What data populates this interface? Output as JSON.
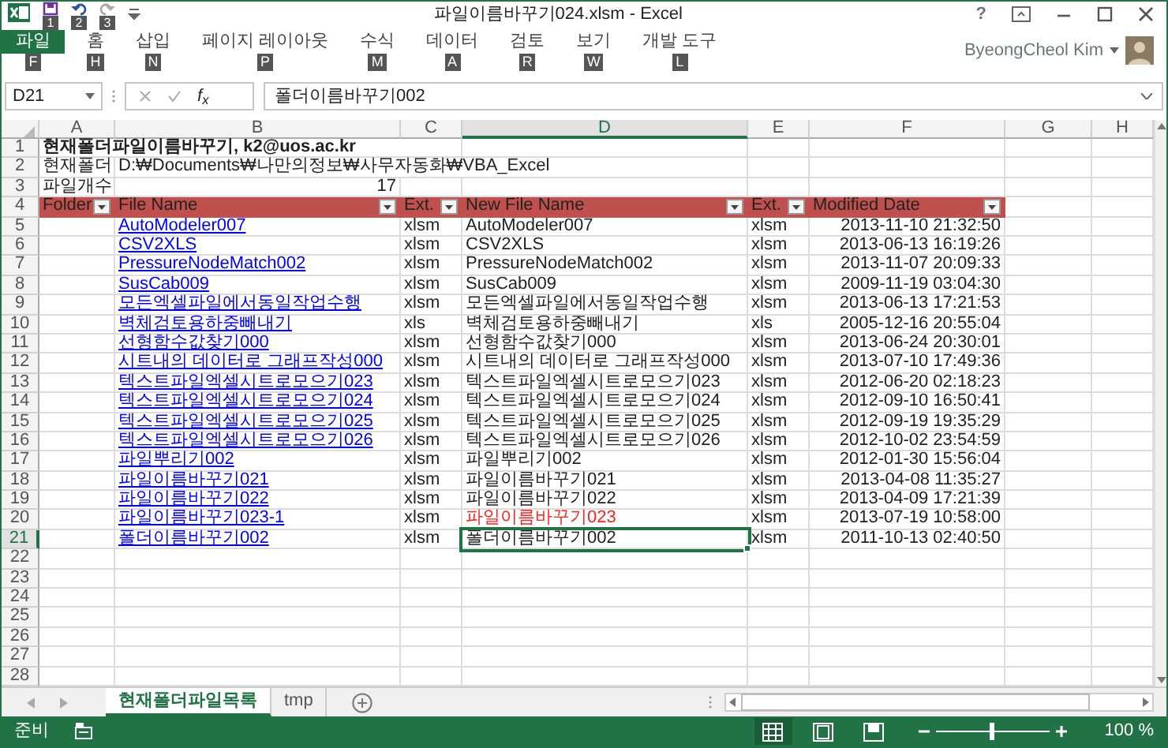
{
  "window": {
    "title": "파일이름바꾸기024.xlsm - Excel",
    "help": "?"
  },
  "quick_access_keytips": [
    "1",
    "2",
    "3"
  ],
  "ribbon_tabs": [
    {
      "label": "파일",
      "keytip": "F",
      "selected": true
    },
    {
      "label": "홈",
      "keytip": "H",
      "selected": false
    },
    {
      "label": "삽입",
      "keytip": "N",
      "selected": false
    },
    {
      "label": "페이지 레이아웃",
      "keytip": "P",
      "selected": false
    },
    {
      "label": "수식",
      "keytip": "M",
      "selected": false
    },
    {
      "label": "데이터",
      "keytip": "A",
      "selected": false
    },
    {
      "label": "검토",
      "keytip": "R",
      "selected": false
    },
    {
      "label": "보기",
      "keytip": "W",
      "selected": false
    },
    {
      "label": "개발 도구",
      "keytip": "L",
      "selected": false
    }
  ],
  "user": {
    "name": "ByeongCheol Kim"
  },
  "formula_bar": {
    "name_box": "D21",
    "function_label": "f$_{x}$",
    "value": "폴더이름바꾸기002"
  },
  "columns": [
    {
      "label": "A",
      "selected": false
    },
    {
      "label": "B",
      "selected": false
    },
    {
      "label": "C",
      "selected": false
    },
    {
      "label": "D",
      "selected": true
    },
    {
      "label": "E",
      "selected": false
    },
    {
      "label": "F",
      "selected": false
    },
    {
      "label": "G",
      "selected": false
    },
    {
      "label": "H",
      "selected": false
    }
  ],
  "rows": [
    {
      "number": "1",
      "selected": false,
      "kind": "title",
      "text": "현재폴더파일이름바꾸기, k2@uos.ac.kr"
    },
    {
      "number": "2",
      "selected": false,
      "kind": "info",
      "label": "현재폴더",
      "value": "D:₩Documents₩나만의정보₩사무자동화₩VBA_Excel"
    },
    {
      "number": "3",
      "selected": false,
      "kind": "count",
      "label": "파일개수",
      "value": "17"
    },
    {
      "number": "4",
      "selected": false,
      "kind": "header",
      "cells": [
        "Folder",
        "File Name",
        "Ext.",
        "New File Name",
        "Ext.",
        "Modified Date"
      ]
    },
    {
      "number": "5",
      "selected": false,
      "kind": "file",
      "file_name": "AutoModeler007",
      "ext": "xlsm",
      "new_name": "AutoModeler007",
      "new_ext": "xlsm",
      "modified": "2013-11-10 21:32:50",
      "conflict": false,
      "active": false
    },
    {
      "number": "6",
      "selected": false,
      "kind": "file",
      "file_name": "CSV2XLS",
      "ext": "xlsm",
      "new_name": "CSV2XLS",
      "new_ext": "xlsm",
      "modified": "2013-06-13 16:19:26",
      "conflict": false,
      "active": false
    },
    {
      "number": "7",
      "selected": false,
      "kind": "file",
      "file_name": "PressureNodeMatch002",
      "ext": "xlsm",
      "new_name": "PressureNodeMatch002",
      "new_ext": "xlsm",
      "modified": "2013-11-07 20:09:33",
      "conflict": false,
      "active": false
    },
    {
      "number": "8",
      "selected": false,
      "kind": "file",
      "file_name": "SusCab009",
      "ext": "xlsm",
      "new_name": "SusCab009",
      "new_ext": "xlsm",
      "modified": "2009-11-19 03:04:30",
      "conflict": false,
      "active": false
    },
    {
      "number": "9",
      "selected": false,
      "kind": "file",
      "file_name": "모든엑셀파일에서동일작업수행",
      "ext": "xlsm",
      "new_name": "모든엑셀파일에서동일작업수행",
      "new_ext": "xlsm",
      "modified": "2013-06-13 17:21:53",
      "conflict": false,
      "active": false
    },
    {
      "number": "10",
      "selected": false,
      "kind": "file",
      "file_name": "벽체검토용하중빼내기",
      "ext": "xls",
      "new_name": "벽체검토용하중빼내기",
      "new_ext": "xls",
      "modified": "2005-12-16 20:55:04",
      "conflict": false,
      "active": false
    },
    {
      "number": "11",
      "selected": false,
      "kind": "file",
      "file_name": "선형함수값찾기000",
      "ext": "xlsm",
      "new_name": "선형함수값찾기000",
      "new_ext": "xlsm",
      "modified": "2013-06-24 20:30:01",
      "conflict": false,
      "active": false
    },
    {
      "number": "12",
      "selected": false,
      "kind": "file",
      "file_name": "시트내의 데이터로 그래프작성000",
      "ext": "xlsm",
      "new_name": "시트내의 데이터로 그래프작성000",
      "new_ext": "xlsm",
      "modified": "2013-07-10 17:49:36",
      "conflict": false,
      "active": false
    },
    {
      "number": "13",
      "selected": false,
      "kind": "file",
      "file_name": "텍스트파일엑셀시트로모으기023",
      "ext": "xlsm",
      "new_name": "텍스트파일엑셀시트로모으기023",
      "new_ext": "xlsm",
      "modified": "2012-06-20 02:18:23",
      "conflict": false,
      "active": false
    },
    {
      "number": "14",
      "selected": false,
      "kind": "file",
      "file_name": "텍스트파일엑셀시트로모으기024",
      "ext": "xlsm",
      "new_name": "텍스트파일엑셀시트로모으기024",
      "new_ext": "xlsm",
      "modified": "2012-09-10 16:50:41",
      "conflict": false,
      "active": false
    },
    {
      "number": "15",
      "selected": false,
      "kind": "file",
      "file_name": "텍스트파일엑셀시트로모으기025",
      "ext": "xlsm",
      "new_name": "텍스트파일엑셀시트로모으기025",
      "new_ext": "xlsm",
      "modified": "2012-09-19 19:35:29",
      "conflict": false,
      "active": false
    },
    {
      "number": "16",
      "selected": false,
      "kind": "file",
      "file_name": "텍스트파일엑셀시트로모으기026",
      "ext": "xlsm",
      "new_name": "텍스트파일엑셀시트로모으기026",
      "new_ext": "xlsm",
      "modified": "2012-10-02 23:54:59",
      "conflict": false,
      "active": false
    },
    {
      "number": "17",
      "selected": false,
      "kind": "file",
      "file_name": "파일뿌리기002",
      "ext": "xlsm",
      "new_name": "파일뿌리기002",
      "new_ext": "xlsm",
      "modified": "2012-01-30 15:56:04",
      "conflict": false,
      "active": false
    },
    {
      "number": "18",
      "selected": false,
      "kind": "file",
      "file_name": "파일이름바꾸기021",
      "ext": "xlsm",
      "new_name": "파일이름바꾸기021",
      "new_ext": "xlsm",
      "modified": "2013-04-08 11:35:27",
      "conflict": false,
      "active": false
    },
    {
      "number": "19",
      "selected": false,
      "kind": "file",
      "file_name": "파일이름바꾸기022",
      "ext": "xlsm",
      "new_name": "파일이름바꾸기022",
      "new_ext": "xlsm",
      "modified": "2013-04-09 17:21:39",
      "conflict": false,
      "active": false
    },
    {
      "number": "20",
      "selected": false,
      "kind": "file",
      "file_name": "파일이름바꾸기023-1",
      "ext": "xlsm",
      "new_name": "파일이름바꾸기023",
      "new_ext": "xlsm",
      "modified": "2013-07-19 10:58:00",
      "conflict": true,
      "active": false
    },
    {
      "number": "21",
      "selected": true,
      "kind": "file",
      "file_name": "폴더이름바꾸기002",
      "ext": "xlsm",
      "new_name": "폴더이름바꾸기002",
      "new_ext": "xlsm",
      "modified": "2011-10-13 02:40:50",
      "conflict": false,
      "active": true
    },
    {
      "number": "22",
      "selected": false,
      "kind": "empty"
    },
    {
      "number": "23",
      "selected": false,
      "kind": "empty"
    },
    {
      "number": "24",
      "selected": false,
      "kind": "empty"
    },
    {
      "number": "25",
      "selected": false,
      "kind": "empty"
    },
    {
      "number": "26",
      "selected": false,
      "kind": "empty"
    },
    {
      "number": "27",
      "selected": false,
      "kind": "empty"
    },
    {
      "number": "28",
      "selected": false,
      "kind": "empty"
    }
  ],
  "sheet_tabs": [
    {
      "label": "현재폴더파일목록",
      "selected": true
    },
    {
      "label": "tmp",
      "selected": false
    }
  ],
  "status_bar": {
    "text": "준비",
    "views": [
      {
        "kind": "normal",
        "selected": true
      },
      {
        "kind": "page_layout",
        "selected": false
      },
      {
        "kind": "page_break",
        "selected": false
      }
    ],
    "zoom_slider": {
      "level": 0.5
    },
    "zoom": "100 %"
  }
}
